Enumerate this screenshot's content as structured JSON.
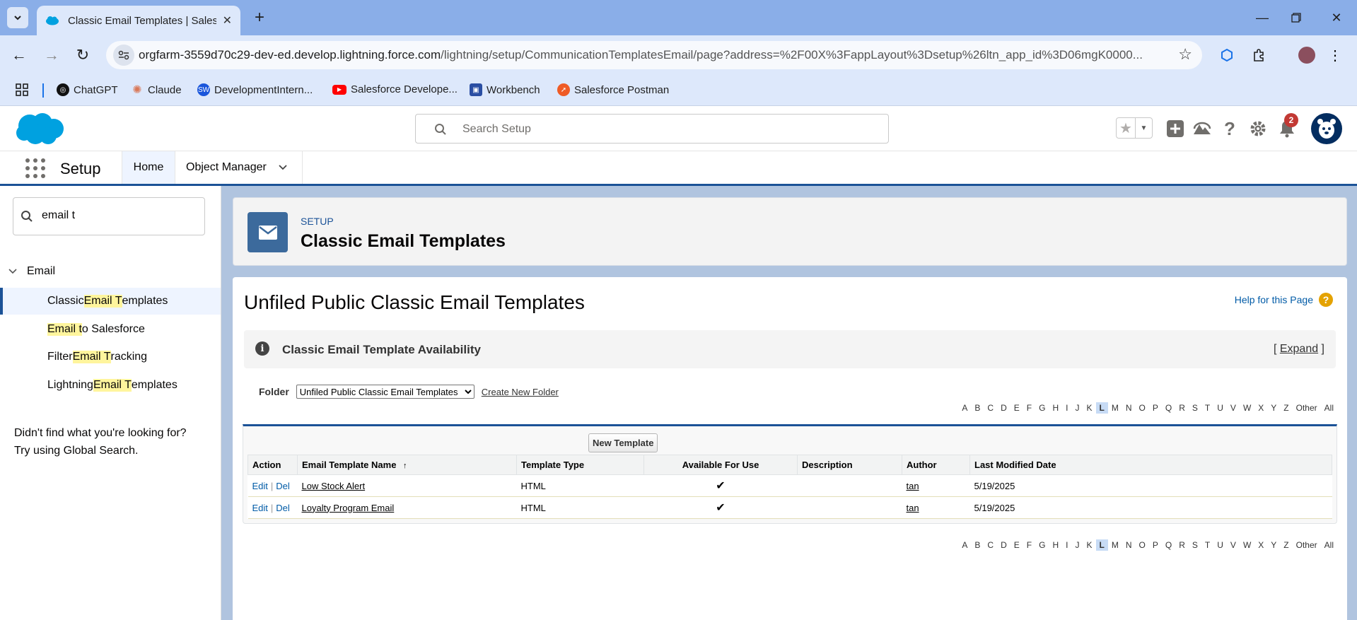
{
  "browser": {
    "tab_title": "Classic Email Templates | Salesforce",
    "url_host": "orgfarm-3559d70c29-dev-ed.develop.lightning.force.com",
    "url_path": "/lightning/setup/CommunicationTemplatesEmail/page?address=%2F00X%3FappLayout%3Dsetup%26ltn_app_id%3D06mgK0000...",
    "bookmarks": [
      {
        "label": "ChatGPT",
        "icon": "chatgpt-icon",
        "color": "#111111"
      },
      {
        "label": "Claude",
        "icon": "claude-icon",
        "color": "#d97757"
      },
      {
        "label": "DevelopmentIntern...",
        "icon": "sw-icon",
        "color": "#1a56db"
      },
      {
        "label": "Salesforce Develope...",
        "icon": "youtube-icon",
        "color": "#ff0000"
      },
      {
        "label": "Workbench",
        "icon": "workbench-icon",
        "color": "#2a4ea3"
      },
      {
        "label": "Salesforce Postman",
        "icon": "postman-icon",
        "color": "#ef5b25"
      }
    ]
  },
  "header": {
    "search_placeholder": "Search Setup",
    "notification_count": "2"
  },
  "nav": {
    "app_name": "Setup",
    "tabs": [
      {
        "label": "Home"
      },
      {
        "label": "Object Manager"
      }
    ]
  },
  "sidebar": {
    "quickfind_value": "email t",
    "group": "Email",
    "items": [
      {
        "pre": "Classic ",
        "hl": "Email T",
        "post": "emplates"
      },
      {
        "pre": "",
        "hl": "Email t",
        "post": "o Salesforce"
      },
      {
        "pre": "Filter ",
        "hl": "Email T",
        "post": "racking"
      },
      {
        "pre": "Lightning ",
        "hl": "Email T",
        "post": "emplates"
      }
    ],
    "help_line1": "Didn't find what you're looking for?",
    "help_line2": "Try using Global Search."
  },
  "page_header": {
    "eyebrow": "SETUP",
    "title": "Classic Email Templates"
  },
  "content": {
    "title": "Unfiled Public Classic Email Templates",
    "help_link": "Help for this Page",
    "availability_title": "Classic Email Template Availability",
    "expand_open": "[ ",
    "expand_label": "Expand",
    "expand_close": " ]",
    "folder_label": "Folder",
    "folder_selected": "Unfiled Public Classic Email Templates",
    "create_folder": "Create New Folder",
    "alpha": [
      "A",
      "B",
      "C",
      "D",
      "E",
      "F",
      "G",
      "H",
      "I",
      "J",
      "K",
      "L",
      "M",
      "N",
      "O",
      "P",
      "Q",
      "R",
      "S",
      "T",
      "U",
      "V",
      "W",
      "X",
      "Y",
      "Z",
      "Other",
      "All"
    ],
    "alpha_selected": "L",
    "new_template_button": "New Template",
    "columns": [
      "Action",
      "Email Template Name",
      "Template Type",
      "Available For Use",
      "Description",
      "Author",
      "Last Modified Date"
    ],
    "sort_arrow": "↑",
    "edit_label": "Edit",
    "del_label": "Del",
    "rows": [
      {
        "name": "Low Stock Alert",
        "type": "HTML",
        "available": "✔",
        "description": "",
        "author": "tan",
        "modified": "5/19/2025"
      },
      {
        "name": "Loyalty Program Email",
        "type": "HTML",
        "available": "✔",
        "description": "",
        "author": "tan",
        "modified": "5/19/2025"
      }
    ]
  },
  "colors": {
    "brand_blue": "#1b5297",
    "salesforce_cloud": "#00a1e0",
    "notification_red": "#c23934"
  }
}
